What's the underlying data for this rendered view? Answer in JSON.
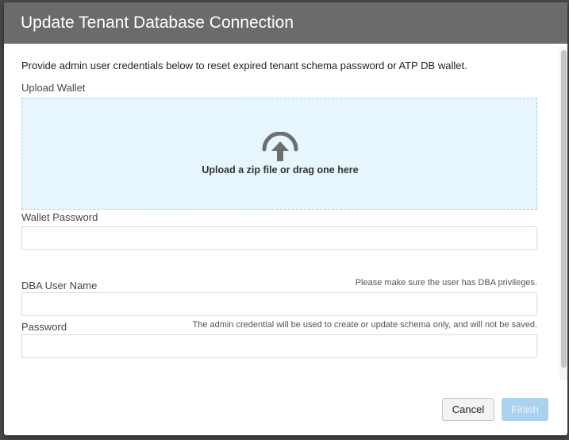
{
  "dialog": {
    "title": "Update Tenant Database Connection",
    "intro": "Provide admin user credentials below to reset expired tenant schema password or ATP DB wallet."
  },
  "upload_wallet": {
    "label": "Upload Wallet",
    "dropzone_text": "Upload a zip file or drag one here",
    "icon": "upload-arrow-icon"
  },
  "wallet_password": {
    "label": "Wallet Password",
    "value": "",
    "placeholder": ""
  },
  "dba_user_name": {
    "label": "DBA User Name",
    "hint": "Please make sure the user has DBA privileges.",
    "value": "",
    "placeholder": ""
  },
  "password": {
    "label": "Password",
    "hint": "The admin credential will be used to create or update schema only, and will not be saved.",
    "value": "",
    "placeholder": ""
  },
  "buttons": {
    "cancel": "Cancel",
    "finish": "Finish"
  },
  "colors": {
    "header_bg": "#6b6b6b",
    "dropzone_bg": "#e6f6fc",
    "dropzone_border": "#9fd3ea",
    "finish_disabled_bg": "#a9d3ee"
  }
}
